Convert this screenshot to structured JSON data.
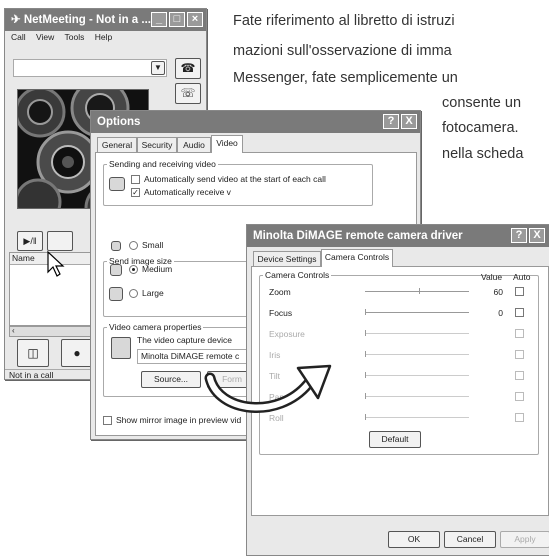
{
  "paragraph": {
    "line1": "Fate riferimento al libretto di istruzi",
    "line2": "mazioni sull'osservazione di imma",
    "line3": "Messenger, fate semplicemente un",
    "line4": "consente un",
    "line5": "fotocamera.",
    "line6": "nella scheda"
  },
  "netmeeting": {
    "title": "NetMeeting - Not in a ...",
    "menu": [
      "Call",
      "View",
      "Tools",
      "Help"
    ],
    "name_label": "Name",
    "status": "Not in a call"
  },
  "options": {
    "title": "Options",
    "help": "?",
    "close": "X",
    "tabs": [
      "General",
      "Security",
      "Audio",
      "Video"
    ],
    "sending_group": "Sending and receiving video",
    "auto_send": "Automatically send video at the start of each call",
    "auto_receive": "Automatically receive v",
    "size_group": "Send image size",
    "sizes": [
      "Small",
      "Medium",
      "Large"
    ],
    "camera_group": "Video camera properties",
    "capture_text": "The video capture device",
    "device_value": "Minolta DiMAGE remote c",
    "source_button": "Source...",
    "format_button": "Form",
    "mirror_label": "Show mirror image in preview vid"
  },
  "driver": {
    "title": "Minolta DiMAGE remote camera driver",
    "help": "?",
    "close": "X",
    "tabs": [
      "Device Settings",
      "Camera Controls"
    ],
    "group": "Camera Controls",
    "col_value": "Value",
    "col_auto": "Auto",
    "rows": [
      {
        "label": "Zoom",
        "value": "60",
        "enabled": true,
        "level": 0.52
      },
      {
        "label": "Focus",
        "value": "0",
        "enabled": true,
        "level": 0.0
      },
      {
        "label": "Exposure",
        "value": "",
        "enabled": false,
        "level": 0.0
      },
      {
        "label": "Iris",
        "value": "",
        "enabled": false,
        "level": 0.0
      },
      {
        "label": "Tilt",
        "value": "",
        "enabled": false,
        "level": 0.0
      },
      {
        "label": "Pan",
        "value": "",
        "enabled": false,
        "level": 0.0
      },
      {
        "label": "Roll",
        "value": "",
        "enabled": false,
        "level": 0.0
      }
    ],
    "default_button": "Default",
    "ok_button": "OK",
    "cancel_button": "Cancel",
    "apply_button": "Apply"
  }
}
